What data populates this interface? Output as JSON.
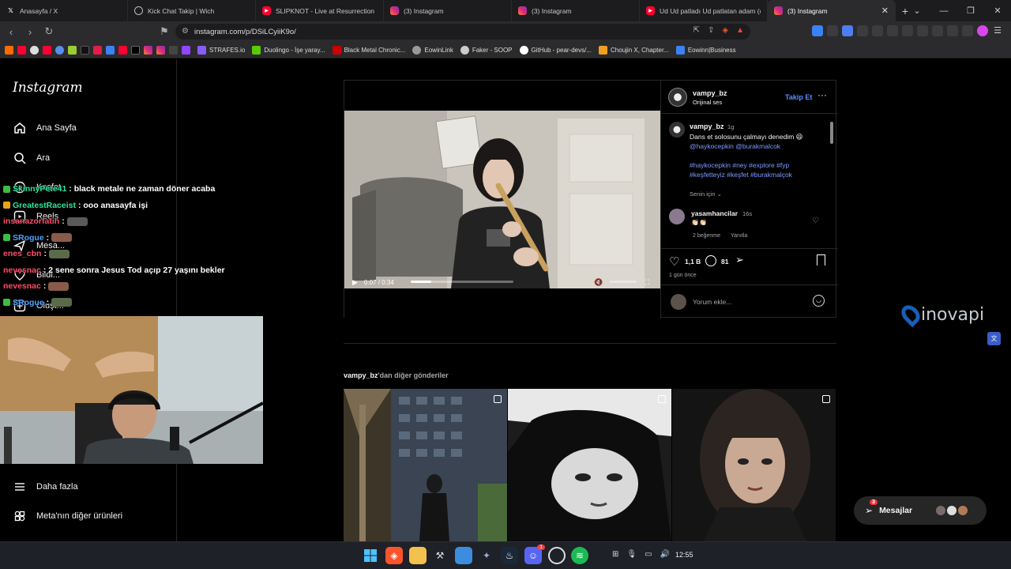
{
  "browser": {
    "tabs": [
      {
        "label": "Anasayfa / X",
        "icon": "x-icon",
        "color": "#ffffff",
        "active": false
      },
      {
        "label": "Kick Chat Takip | Wich",
        "icon": "globe-icon",
        "color": "#bbbbbb",
        "active": false
      },
      {
        "label": "SLIPKNOT - Live at Resurrection Fest",
        "icon": "youtube-icon",
        "color": "#ff0033",
        "active": false
      },
      {
        "label": "(3) Instagram",
        "icon": "instagram-icon",
        "color": "#e1306c",
        "active": false
      },
      {
        "label": "(3) Instagram",
        "icon": "instagram-icon",
        "color": "#e1306c",
        "active": false
      },
      {
        "label": "Ud Ud patladı Ud patlatan adam (ca",
        "icon": "youtube-icon",
        "color": "#ff0033",
        "active": false
      },
      {
        "label": "(3) Instagram",
        "icon": "instagram-icon",
        "color": "#e1306c",
        "active": true
      }
    ],
    "url": "instagram.com/p/DSiLCyiiK9o/",
    "bookmarks": [
      {
        "label": "STRAFES.io",
        "color": "#8a5cf6"
      },
      {
        "label": "Duolingo - İşe yaray...",
        "color": "#58cc02"
      },
      {
        "label": "Black Metal Chronic...",
        "color": "#cc0000"
      },
      {
        "label": "EowinLink",
        "color": "#999999"
      },
      {
        "label": "Faker - SOOP",
        "color": "#cccccc"
      },
      {
        "label": "GitHub - pear-devs/...",
        "color": "#ffffff"
      },
      {
        "label": "Choujin X, Chapter...",
        "color": "#f0a020"
      },
      {
        "label": "Eowinn|Business",
        "color": "#3b82f6"
      }
    ]
  },
  "instagram": {
    "logo": "Instagram",
    "nav": {
      "home": "Ana Sayfa",
      "search": "Ara",
      "explore": "Keşfet",
      "reels": "Reels",
      "messages": "Mesa...",
      "notifications": "Bildi...",
      "create": "Oluşt...",
      "more": "Daha fazla",
      "meta": "Meta'nın diğer ürünleri"
    },
    "post": {
      "username": "vampy_bz",
      "audio": "Orijinal ses",
      "follow": "Takip Et",
      "caption_time": "1g",
      "caption_line1": "Dans et solosunu çalmayı denedim 😆",
      "caption_mentions": "@haykocepkin @burakmalcok",
      "hashtags_line1": "#haykocepkin #ney #explore #fyp",
      "hashtags_line2": "#keşfetteyiz #keşfet #burakmalçok",
      "for_you": "Senin için",
      "comment_user": "yasamhancilar",
      "comment_time": "16s",
      "comment_text": "👏🏻👏🏻",
      "comment_likes": "2 beğenme",
      "comment_reply": "Yanıtla",
      "likes": "1,1 B",
      "comments": "81",
      "posted": "1 gün önce",
      "add_comment": "Yorum ekle...",
      "video_time": "0:07 / 0:34",
      "video_progress": 0.2
    },
    "more_posts_user": "vampy_bz",
    "more_posts_suffix": "'dan diğer gönderiler",
    "messages_button": "Mesajlar",
    "messages_badge": "3"
  },
  "chat": [
    {
      "user": "SkinnyPete41",
      "user_color": "#2ee59d",
      "message": ": black metale ne zaman döner acaba",
      "badge": "#3bbd44"
    },
    {
      "user": "GreatestRaceist",
      "user_color": "#2ee59d",
      "message": ": ooo anasayfa işi",
      "badge": "#e8a317"
    },
    {
      "user": "insanazorfatih",
      "user_color": "#ff4d6a",
      "message": ":",
      "badge": ""
    },
    {
      "user": "SRogue",
      "user_color": "#4aa3ff",
      "message": ":",
      "badge": "#3bbd44"
    },
    {
      "user": "enes_cbn",
      "user_color": "#ff4d6a",
      "message": ":",
      "badge": ""
    },
    {
      "user": "nevesnac",
      "user_color": "#ff4d6a",
      "message": ": 2 sene sonra Jesus Tod açıp 27 yaşını bekler",
      "badge": ""
    },
    {
      "user": "nevesnac",
      "user_color": "#ff4d6a",
      "message": ":",
      "badge": ""
    },
    {
      "user": "SRogue",
      "user_color": "#4aa3ff",
      "message": ":",
      "badge": "#3bbd44"
    }
  ],
  "overlay": {
    "watermark": "inovapi"
  },
  "taskbar": {
    "clock": "12:55",
    "discord_badge": "1"
  }
}
